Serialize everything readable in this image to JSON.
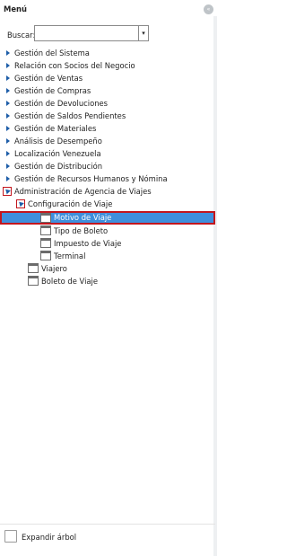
{
  "header": {
    "title": "Menú",
    "collapse_icon": "collapse-icon"
  },
  "search": {
    "label": "Buscar:",
    "value": ""
  },
  "tree": {
    "items": [
      {
        "label": "Gestión del Sistema"
      },
      {
        "label": "Relación con Socios del Negocio"
      },
      {
        "label": "Gestión de Ventas"
      },
      {
        "label": "Gestión de Compras"
      },
      {
        "label": "Gestión de Devoluciones"
      },
      {
        "label": "Gestión de Saldos Pendientes"
      },
      {
        "label": "Gestión de Materiales"
      },
      {
        "label": "Análisis de Desempeño"
      },
      {
        "label": "Localización Venezuela"
      },
      {
        "label": "Gestión de Distribución"
      },
      {
        "label": "Gestión de Recursos Humanos y Nómina"
      },
      {
        "label": "Administración de Agencia de Viajes"
      },
      {
        "label": "Configuración de Viaje"
      },
      {
        "label": "Motivo de Viaje"
      },
      {
        "label": "Tipo de Boleto"
      },
      {
        "label": "Impuesto de Viaje"
      },
      {
        "label": "Terminal"
      },
      {
        "label": "Viajero"
      },
      {
        "label": "Boleto de Viaje"
      }
    ],
    "selected": "Motivo de Viaje"
  },
  "footer": {
    "expand_label": "Expandir árbol",
    "expand_checked": false
  },
  "colors": {
    "selection": "#3f8fdc",
    "highlight_border": "#c3161d",
    "triangle": "#1d5da8"
  }
}
